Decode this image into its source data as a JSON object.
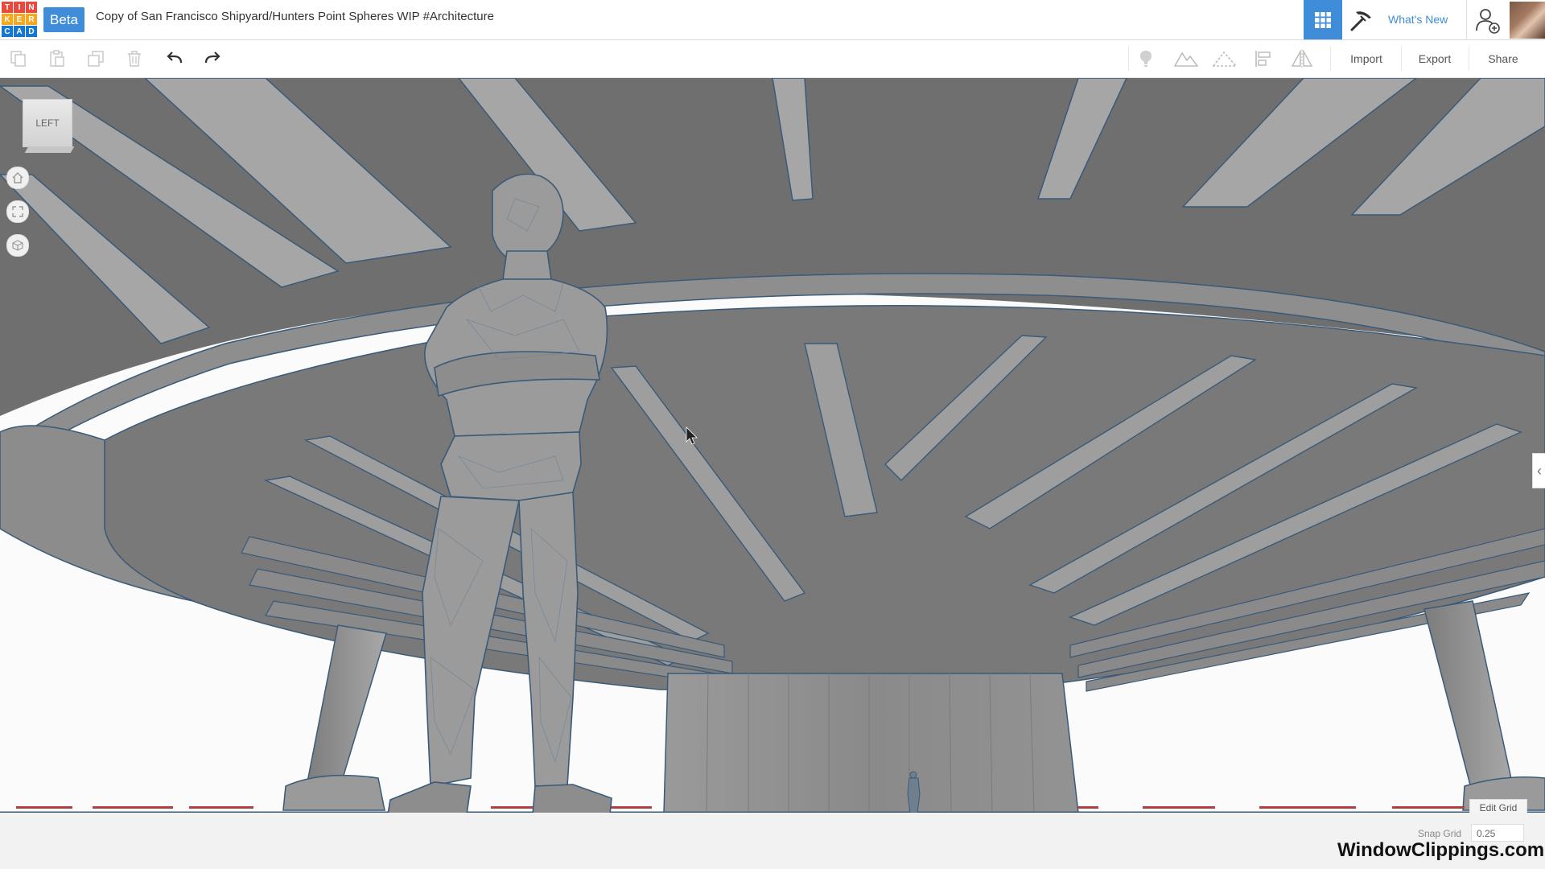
{
  "header": {
    "logo_letters": [
      "T",
      "I",
      "N",
      "K",
      "E",
      "R",
      "C",
      "A",
      "D"
    ],
    "beta_badge": "Beta",
    "title": "Copy of San Francisco Shipyard/Hunters Point Spheres WIP #Architecture",
    "whats_new": "What's New",
    "icons": {
      "grid_view": "grid-icon",
      "workplane": "pickaxe-icon",
      "add_user": "add-user-icon"
    }
  },
  "toolbar": {
    "left_icons": [
      "copy-icon",
      "paste-icon",
      "duplicate-icon",
      "trash-icon",
      "undo-icon",
      "redo-icon"
    ],
    "right_icons": [
      "light-bulb-icon",
      "solid-shape-icon",
      "hole-shape-icon",
      "align-icon",
      "mirror-icon"
    ],
    "import_label": "Import",
    "export_label": "Export",
    "share_label": "Share"
  },
  "viewport": {
    "view_cube_label": "LEFT",
    "nav_icons": [
      "home-icon",
      "fit-view-icon",
      "ortho-icon"
    ],
    "edit_grid_label": "Edit Grid"
  },
  "footer": {
    "snap_grid_label": "Snap Grid",
    "snap_grid_value": "0.25",
    "watermark": "WindowClippings.com"
  },
  "colors": {
    "accent": "#3f8dd8",
    "logo_tiles": [
      "#e94a3f",
      "#e94a3f",
      "#e94a3f",
      "#f7a81b",
      "#f7a81b",
      "#f7a81b",
      "#1477d1",
      "#1477d1",
      "#1477d1"
    ],
    "model_dark": "#6f6f6f",
    "model_mid": "#8e8e8e",
    "model_light": "#a6a6a6",
    "edge": "#3a5a78"
  }
}
